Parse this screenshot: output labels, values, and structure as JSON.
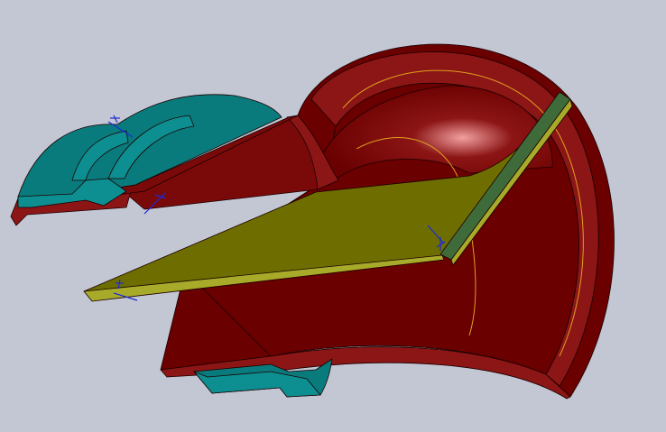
{
  "viewport": {
    "background_color": "#c3c6d3"
  },
  "colors": {
    "shell_dark": "#6a0000",
    "shell_mid": "#7a0a0a",
    "shell_light": "#8c1515",
    "shell_highlight": "#f2a0a0",
    "flange_top": "#0a7b7d",
    "flange_side": "#0d8e90",
    "plate_top": "#6e6e00",
    "plate_edge": "#a8aa2a",
    "plate_side": "#3f6b3a",
    "reference_line": "#e0a020",
    "dimension_marker": "#1a2ad8"
  },
  "parts": [
    {
      "name": "horn-shell",
      "color_key": "shell_mid"
    },
    {
      "name": "mounting-flange",
      "color_key": "flange_top"
    },
    {
      "name": "septum-plate",
      "color_key": "plate_top"
    }
  ]
}
